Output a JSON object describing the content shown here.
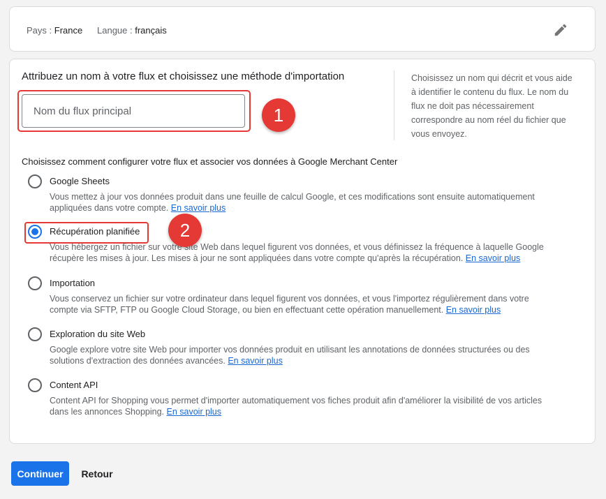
{
  "header": {
    "country_label": "Pays :",
    "country_value": "France",
    "language_label": "Langue :",
    "language_value": "français",
    "edit_icon": "pencil-icon"
  },
  "name_section": {
    "title": "Attribuez un nom à votre flux et choisissez une méthode d'importation",
    "input_placeholder": "Nom du flux principal",
    "input_value": "",
    "help": "Choisissez un nom qui décrit et vous aide à identifier le contenu du flux. Le nom du flux ne doit pas nécessairement correspondre au nom réel du fichier que vous envoyez."
  },
  "annotations": {
    "badge1": "1",
    "badge2": "2",
    "highlight_color": "#e53935"
  },
  "config": {
    "title": "Choisissez comment configurer votre flux et associer vos données à Google Merchant Center",
    "link_label": "En savoir plus",
    "options": [
      {
        "label": "Google Sheets",
        "checked": false,
        "desc": "Vous mettez à jour vos données produit dans une feuille de calcul Google, et ces modifications sont ensuite automatiquement appliquées dans votre compte."
      },
      {
        "label": "Récupération planifiée",
        "checked": true,
        "desc": "Vous hébergez un fichier sur votre site Web dans lequel figurent vos données, et vous définissez la fréquence à laquelle Google récupère les mises à jour. Les mises à jour ne sont appliquées dans votre compte qu'après la récupération."
      },
      {
        "label": "Importation",
        "checked": false,
        "desc": "Vous conservez un fichier sur votre ordinateur dans lequel figurent vos données, et vous l'importez régulièrement dans votre compte via SFTP, FTP ou Google Cloud Storage, ou bien en effectuant cette opération manuellement."
      },
      {
        "label": "Exploration du site Web",
        "checked": false,
        "desc": "Google explore votre site Web pour importer vos données produit en utilisant les annotations de données structurées ou des solutions d'extraction des données avancées."
      },
      {
        "label": "Content API",
        "checked": false,
        "desc": "Content API for Shopping vous permet d'importer automatiquement vos fiches produit afin d'améliorer la visibilité de vos articles dans les annonces Shopping."
      }
    ]
  },
  "footer": {
    "continue_label": "Continuer",
    "back_label": "Retour"
  },
  "colors": {
    "accent": "#1a73e8",
    "link": "#1967d2",
    "annotation": "#e53935"
  }
}
